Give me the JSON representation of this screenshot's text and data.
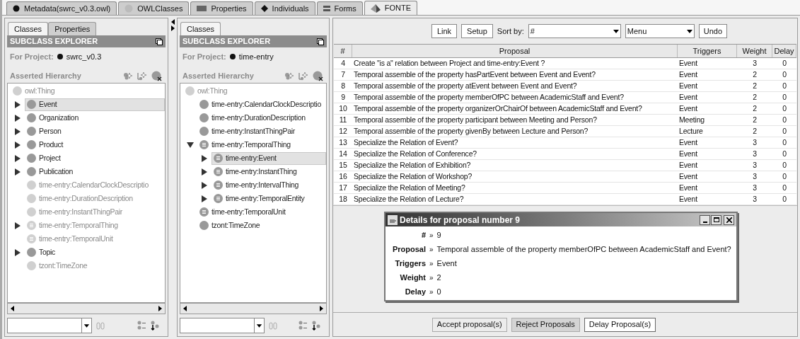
{
  "tabs": [
    {
      "label": "Metadata(swrc_v0.3.owl)",
      "selected": false
    },
    {
      "label": "OWLClasses",
      "selected": false
    },
    {
      "label": "Properties",
      "selected": false
    },
    {
      "label": "Individuals",
      "selected": false
    },
    {
      "label": "Forms",
      "selected": false
    },
    {
      "label": "FONTE",
      "selected": true
    }
  ],
  "explorers": [
    {
      "tabs": [
        {
          "label": "Classes",
          "selected": true
        },
        {
          "label": "Properties",
          "selected": false
        }
      ],
      "header": "SUBCLASS EXPLORER",
      "project_label": "For Project:",
      "project": "swrc_v0.3",
      "hierarchy_label": "Asserted Hierarchy",
      "tree": [
        {
          "label": "owl:Thing",
          "kind": "class",
          "greyed": true,
          "expandable": false,
          "expanded": false,
          "selected": false,
          "children": [
            {
              "label": "Event",
              "kind": "class",
              "greyed": false,
              "expandable": true,
              "expanded": false,
              "selected": true
            },
            {
              "label": "Organization",
              "kind": "class",
              "greyed": false,
              "expandable": true,
              "expanded": false,
              "selected": false
            },
            {
              "label": "Person",
              "kind": "class",
              "greyed": false,
              "expandable": true,
              "expanded": false,
              "selected": false
            },
            {
              "label": "Product",
              "kind": "class",
              "greyed": false,
              "expandable": true,
              "expanded": false,
              "selected": false
            },
            {
              "label": "Project",
              "kind": "class",
              "greyed": false,
              "expandable": true,
              "expanded": false,
              "selected": false
            },
            {
              "label": "Publication",
              "kind": "class",
              "greyed": false,
              "expandable": true,
              "expanded": false,
              "selected": false
            },
            {
              "label": "time-entry:CalendarClockDescriptio",
              "kind": "class",
              "greyed": true,
              "expandable": false,
              "expanded": false,
              "selected": false
            },
            {
              "label": "time-entry:DurationDescription",
              "kind": "class",
              "greyed": true,
              "expandable": false,
              "expanded": false,
              "selected": false
            },
            {
              "label": "time-entry:InstantThingPair",
              "kind": "class",
              "greyed": true,
              "expandable": false,
              "expanded": false,
              "selected": false
            },
            {
              "label": "time-entry:TemporalThing",
              "kind": "defined",
              "greyed": true,
              "expandable": true,
              "expanded": false,
              "selected": false
            },
            {
              "label": "time-entry:TemporalUnit",
              "kind": "defined",
              "greyed": true,
              "expandable": false,
              "expanded": false,
              "selected": false
            },
            {
              "label": "Topic",
              "kind": "class",
              "greyed": false,
              "expandable": true,
              "expanded": false,
              "selected": false
            },
            {
              "label": "tzont:TimeZone",
              "kind": "class",
              "greyed": true,
              "expandable": false,
              "expanded": false,
              "selected": false
            }
          ]
        }
      ]
    },
    {
      "tabs": [
        {
          "label": "Classes",
          "selected": true
        }
      ],
      "header": "SUBCLASS EXPLORER",
      "project_label": "For Project:",
      "project": "time-entry",
      "hierarchy_label": "Asserted Hierarchy",
      "tree": [
        {
          "label": "owl:Thing",
          "kind": "class",
          "greyed": true,
          "expandable": false,
          "expanded": false,
          "selected": false,
          "children": [
            {
              "label": "time-entry:CalendarClockDescriptio",
              "kind": "class",
              "greyed": false,
              "expandable": false,
              "expanded": false,
              "selected": false
            },
            {
              "label": "time-entry:DurationDescription",
              "kind": "class",
              "greyed": false,
              "expandable": false,
              "expanded": false,
              "selected": false
            },
            {
              "label": "time-entry:InstantThingPair",
              "kind": "class",
              "greyed": false,
              "expandable": false,
              "expanded": false,
              "selected": false
            },
            {
              "label": "time-entry:TemporalThing",
              "kind": "defined",
              "greyed": false,
              "expandable": true,
              "expanded": true,
              "selected": false,
              "children": [
                {
                  "label": "time-entry:Event",
                  "kind": "defined",
                  "greyed": false,
                  "expandable": true,
                  "expanded": false,
                  "selected": true
                },
                {
                  "label": "time-entry:InstantThing",
                  "kind": "defined",
                  "greyed": false,
                  "expandable": true,
                  "expanded": false,
                  "selected": false
                },
                {
                  "label": "time-entry:IntervalThing",
                  "kind": "defined",
                  "greyed": false,
                  "expandable": true,
                  "expanded": false,
                  "selected": false
                },
                {
                  "label": "time-entry:TemporalEntity",
                  "kind": "defined",
                  "greyed": false,
                  "expandable": true,
                  "expanded": false,
                  "selected": false
                }
              ]
            },
            {
              "label": "time-entry:TemporalUnit",
              "kind": "defined",
              "greyed": false,
              "expandable": false,
              "expanded": false,
              "selected": false
            },
            {
              "label": "tzont:TimeZone",
              "kind": "class",
              "greyed": false,
              "expandable": false,
              "expanded": false,
              "selected": false
            }
          ]
        }
      ]
    }
  ],
  "toolbar": {
    "link": "Link",
    "setup": "Setup",
    "sort_label": "Sort by:",
    "sort_value": "#",
    "menu_value": "Menu",
    "undo": "Undo"
  },
  "table": {
    "columns": [
      "#",
      "Proposal",
      "Triggers",
      "Weight",
      "Delay"
    ],
    "rows": [
      [
        "4",
        "Create \"is a\" relation between Project and time-entry:Event ?",
        "Event",
        "3",
        "0"
      ],
      [
        "7",
        "Temporal assemble of the property hasPartEvent between Event and Event?",
        "Event",
        "2",
        "0"
      ],
      [
        "8",
        "Temporal assemble of the property atEvent between Event and Event?",
        "Event",
        "2",
        "0"
      ],
      [
        "9",
        "Temporal assemble of the property memberOfPC between AcademicStaff and Event?",
        "Event",
        "2",
        "0"
      ],
      [
        "10",
        "Temporal assemble of the property organizerOrChairOf between AcademicStaff and Event?",
        "Event",
        "2",
        "0"
      ],
      [
        "11",
        "Temporal assemble of the property participant between Meeting and Person?",
        "Meeting",
        "2",
        "0"
      ],
      [
        "12",
        "Temporal assemble of the property givenBy between Lecture and Person?",
        "Lecture",
        "2",
        "0"
      ],
      [
        "13",
        "Specialize the Relation of Event?",
        "Event",
        "3",
        "0"
      ],
      [
        "14",
        "Specialize the Relation of Conference?",
        "Event",
        "3",
        "0"
      ],
      [
        "15",
        "Specialize the Relation of Exhibition?",
        "Event",
        "3",
        "0"
      ],
      [
        "16",
        "Specialize the Relation of Workshop?",
        "Event",
        "3",
        "0"
      ],
      [
        "17",
        "Specialize the Relation of Meeting?",
        "Event",
        "3",
        "0"
      ],
      [
        "18",
        "Specialize the Relation of Lecture?",
        "Event",
        "3",
        "0"
      ]
    ]
  },
  "dialog": {
    "title": "Details for proposal number 9",
    "separator": "»",
    "fields": [
      {
        "label": "#",
        "value": "9"
      },
      {
        "label": "Proposal",
        "value": "Temporal assemble of the property memberOfPC between AcademicStaff and Event?"
      },
      {
        "label": "Triggers",
        "value": "Event"
      },
      {
        "label": "Weight",
        "value": "2"
      },
      {
        "label": "Delay",
        "value": "0"
      }
    ]
  },
  "actions": [
    {
      "label": "Accept proposal(s)",
      "pressed": false,
      "focused": false
    },
    {
      "label": "Reject Proposals",
      "pressed": true,
      "focused": false
    },
    {
      "label": "Delay Proposal(s)",
      "pressed": false,
      "focused": true
    }
  ]
}
